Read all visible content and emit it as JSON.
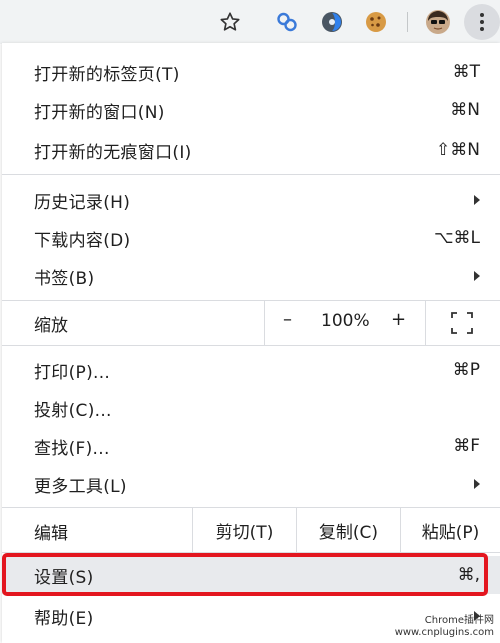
{
  "toolbar": {
    "icons": [
      "star-icon",
      "link-extension-icon",
      "globe-extension-icon",
      "cookie-extension-icon",
      "avatar",
      "kebab-menu-icon"
    ]
  },
  "menu": {
    "group1": [
      {
        "label": "打开新的标签页(T)",
        "shortcut": "⌘T"
      },
      {
        "label": "打开新的窗口(N)",
        "shortcut": "⌘N"
      },
      {
        "label": "打开新的无痕窗口(I)",
        "shortcut": "⇧⌘N"
      }
    ],
    "group2": [
      {
        "label": "历史记录(H)",
        "submenu": true
      },
      {
        "label": "下载内容(D)",
        "shortcut": "⌥⌘L"
      },
      {
        "label": "书签(B)",
        "submenu": true
      }
    ],
    "zoom": {
      "label": "缩放",
      "minus": "–",
      "value": "100%",
      "plus": "+"
    },
    "group3": [
      {
        "label": "打印(P)...",
        "shortcut": "⌘P"
      },
      {
        "label": "投射(C)...",
        "shortcut": ""
      },
      {
        "label": "查找(F)...",
        "shortcut": "⌘F"
      },
      {
        "label": "更多工具(L)",
        "submenu": true
      }
    ],
    "edit": {
      "label": "编辑",
      "cut": "剪切(T)",
      "copy": "复制(C)",
      "paste": "粘贴(P)"
    },
    "settings": {
      "label": "设置(S)",
      "shortcut": "⌘,"
    },
    "help": {
      "label": "帮助(E)",
      "submenu": true
    }
  },
  "colors": {
    "highlight_border": "#e3161f",
    "highlight_bg": "#e8eaed"
  },
  "watermark": {
    "line1": "Chrome插件网",
    "line2": "www.cnplugins.com"
  }
}
